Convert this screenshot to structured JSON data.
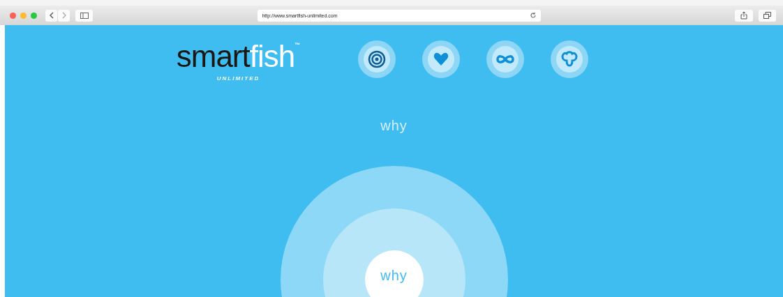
{
  "browser": {
    "url": "http://www.smartfish-unlimited.com"
  },
  "logo": {
    "dark": "smart",
    "light": "fish",
    "trademark": "™",
    "tagline": "UNLIMITED"
  },
  "nav_icons": [
    {
      "kind": "target"
    },
    {
      "kind": "heart"
    },
    {
      "kind": "infinity"
    },
    {
      "kind": "trefoil"
    }
  ],
  "heading": "why",
  "center_label": "why"
}
